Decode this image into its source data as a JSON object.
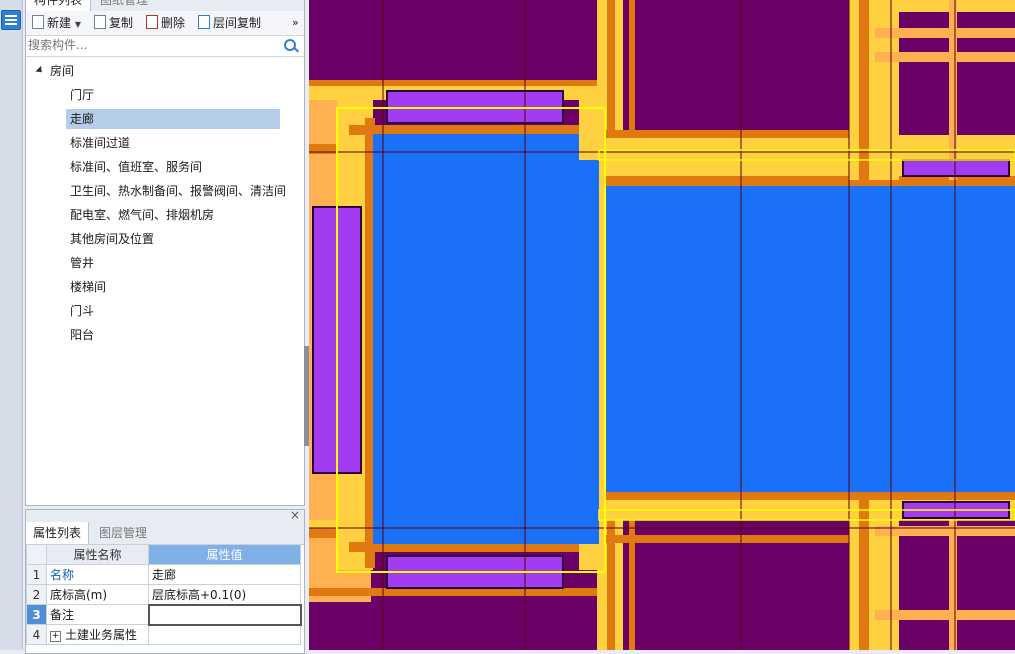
{
  "component_panel": {
    "tabs": [
      "构件列表",
      "图纸管理"
    ],
    "toolbar": {
      "new_label": "新建",
      "copy_label": "复制",
      "delete_label": "删除",
      "floor_copy_label": "层间复制",
      "more_label": "»"
    },
    "search": {
      "placeholder": "搜索构件..."
    },
    "tree": {
      "root_label": "房间",
      "items": [
        "门厅",
        "走廊",
        "标准间过道",
        "标准间、值班室、服务间",
        "卫生间、热水制备间、报警阀间、清洁间",
        "配电室、燃气间、排烟机房",
        "其他房间及位置",
        "管井",
        "楼梯间",
        "门斗",
        "阳台"
      ],
      "selected": "走廊"
    }
  },
  "property_panel": {
    "close_label": "×",
    "tabs": [
      "属性列表",
      "图层管理"
    ],
    "header": {
      "name_col": "属性名称",
      "value_col": "属性值"
    },
    "rows": [
      {
        "num": "1",
        "name": "名称",
        "value": "走廊"
      },
      {
        "num": "2",
        "name": "底标高(m)",
        "value": "层底标高+0.1(0)"
      },
      {
        "num": "3",
        "name": "备注",
        "value": ""
      },
      {
        "num": "4",
        "name": "土建业务属性",
        "value": ""
      }
    ]
  },
  "colors": {
    "wall_purple": "#6b0067",
    "beam_orange": "#e07a10",
    "column_yellow": "#ffd040",
    "room_blue": "#1b70f8",
    "window_violet": "#a33cf0",
    "selection_yellow": "#ffff00"
  }
}
